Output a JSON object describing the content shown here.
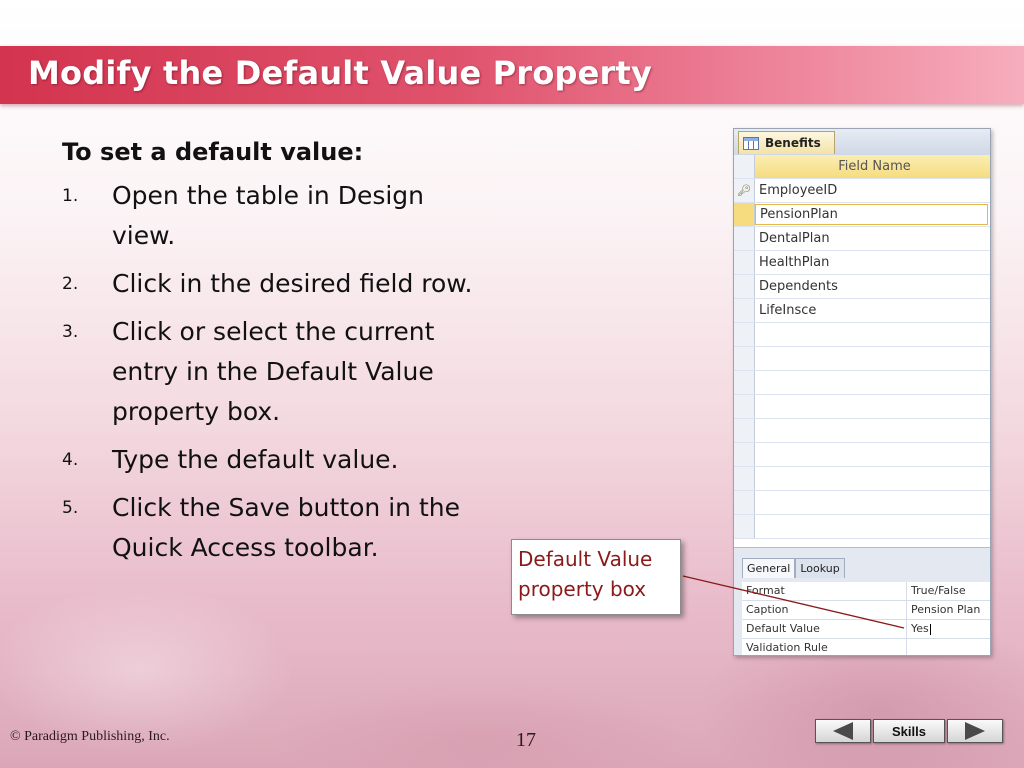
{
  "slide": {
    "title": "Modify the Default Value Property",
    "lead": "To set a default value:",
    "steps": [
      {
        "num": "1.",
        "text": "Open the table in Design view."
      },
      {
        "num": "2.",
        "text": "Click in the desired field row."
      },
      {
        "num": "3.",
        "text": "Click or select the current entry in the Default Value property box."
      },
      {
        "num": "4.",
        "text": "Type the default value."
      },
      {
        "num": "5.",
        "text": "Click the Save button in the Quick Access toolbar."
      }
    ]
  },
  "access": {
    "tab_label": "Benefits",
    "column_header": "Field Name",
    "fields": [
      "EmployeeID",
      "PensionPlan",
      "DentalPlan",
      "HealthPlan",
      "Dependents",
      "LifeInsce"
    ],
    "property_tabs": [
      "General",
      "Lookup"
    ],
    "properties": [
      {
        "label": "Format",
        "value": "True/False"
      },
      {
        "label": "Caption",
        "value": "Pension Plan"
      },
      {
        "label": "Default Value",
        "value": "Yes"
      },
      {
        "label": "Validation Rule",
        "value": ""
      }
    ]
  },
  "callout": {
    "text_line1": "Default Value",
    "text_line2": "property box"
  },
  "footer": {
    "copyright": "© Paradigm Publishing, Inc.",
    "page_number": "17",
    "skills_label": "Skills"
  },
  "colors": {
    "title_bar": "#d3344f",
    "callout_text": "#8b1a1a",
    "active_row": "#f6dc7f"
  }
}
